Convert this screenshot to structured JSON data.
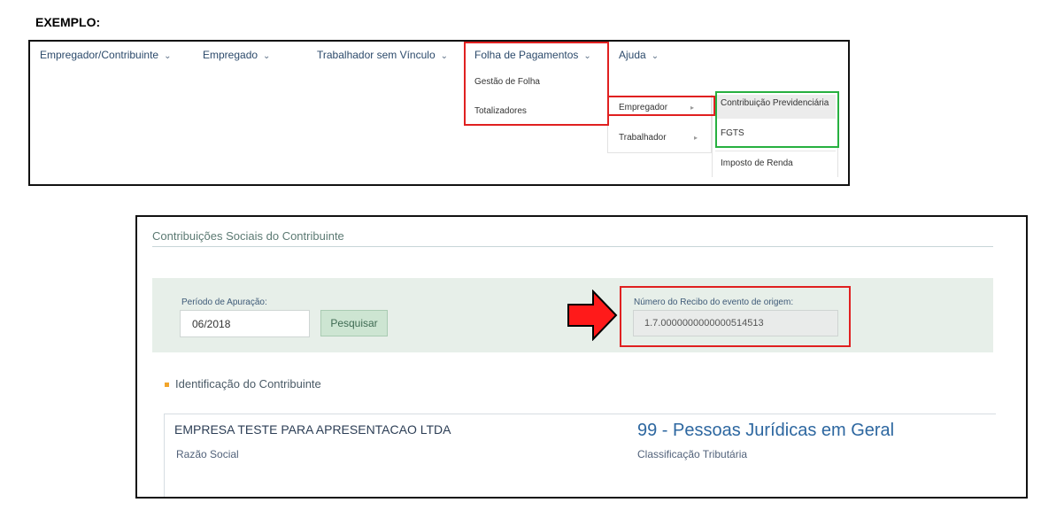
{
  "example_title": "EXEMPLO:",
  "menu": {
    "items": [
      {
        "label": "Empregador/Contribuinte"
      },
      {
        "label": "Empregado"
      },
      {
        "label": "Trabalhador sem Vínculo"
      },
      {
        "label": "Folha de Pagamentos"
      },
      {
        "label": "Ajuda"
      }
    ],
    "folha_dropdown": [
      "Gestão de Folha",
      "Totalizadores"
    ],
    "totalizadores_submenu": [
      "Empregador",
      "Trabalhador"
    ],
    "empregador_submenu": [
      "Contribuição Previdenciária",
      "FGTS",
      "Imposto de Renda"
    ]
  },
  "form": {
    "page_title": "Contribuições Sociais do Contribuinte",
    "periodo_label": "Período de Apuração:",
    "periodo_value": "06/2018",
    "pesquisar_label": "Pesquisar",
    "recibo_label": "Número do Recibo do evento de origem:",
    "recibo_value": "1.7.0000000000000514513",
    "identificacao_title": "Identificação do Contribuinte",
    "company_name": "EMPRESA TESTE PARA APRESENTACAO LTDA",
    "razao_social_label": "Razão Social",
    "classificacao_value": "99 - Pessoas Jurídicas em Geral",
    "classificacao_label": "Classificação Tributária"
  },
  "colors": {
    "highlight_red": "#e02020",
    "highlight_green": "#27b040",
    "arrow_fill": "#ff1a1a",
    "band_bg": "#e7efe9",
    "link_blue": "#2d67a0"
  }
}
